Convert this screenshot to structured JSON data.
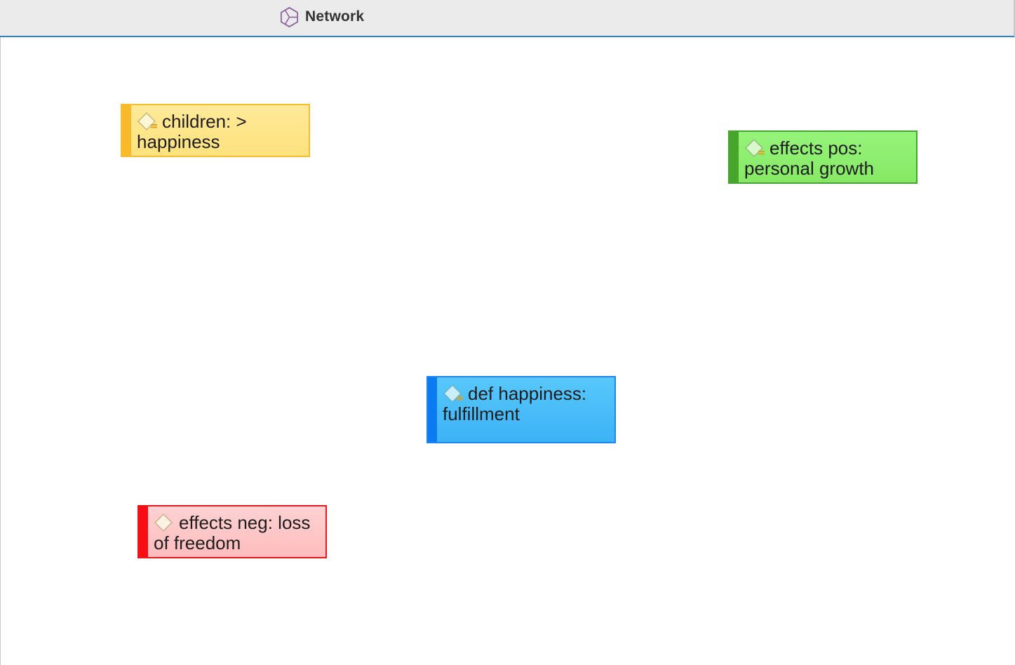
{
  "tab": {
    "title": "Network",
    "icon": "network-icon"
  },
  "colors": {
    "tab_underline": "#2f7fdc",
    "yellow": "#f8b92a",
    "green": "#48a52c",
    "blue": "#0a7bf0",
    "red": "#f80d15"
  },
  "nodes": [
    {
      "icon": "code-icon",
      "label": "children: > happiness",
      "color": "yellow"
    },
    {
      "icon": "code-icon",
      "label": "effects pos: personal growth",
      "color": "green"
    },
    {
      "icon": "code-icon",
      "label": "def happiness: fulfillment",
      "color": "blue"
    },
    {
      "icon": "code-icon",
      "label": "effects neg: loss of freedom",
      "color": "red"
    }
  ]
}
